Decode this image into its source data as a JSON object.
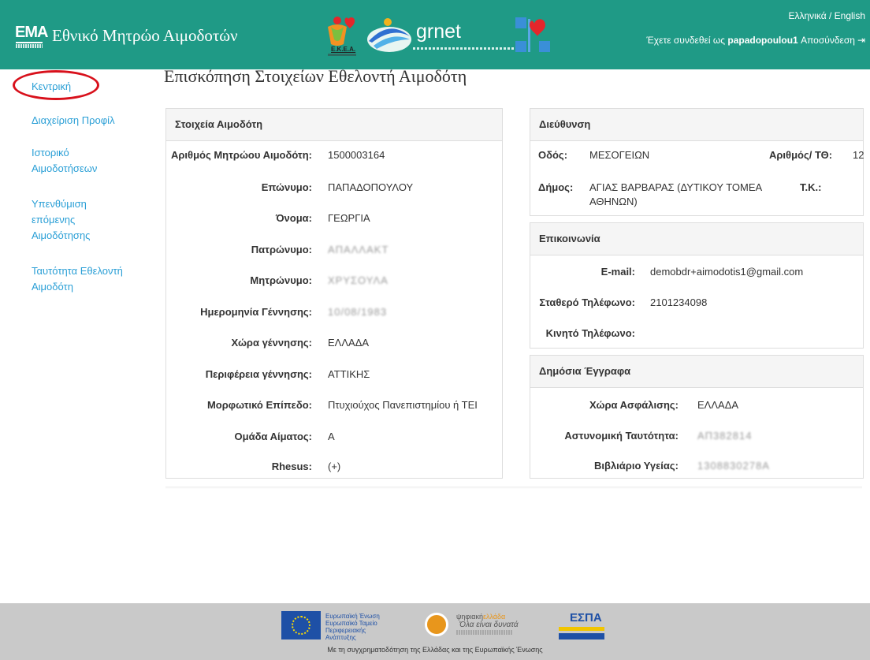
{
  "header": {
    "logo_text": "ΕΜΑ",
    "site_title": "Εθνικό Μητρώο Αιμοδοτών",
    "ekea_label": "Ε.Κ.Ε.Α.",
    "grnet_label": "grnet",
    "language_switch": "Ελληνικά / English",
    "login_prefix": "Έχετε συνδεθεί ως",
    "username": "papadopoulou1",
    "logout_label": "Αποσύνδεση",
    "colors": {
      "header_bg": "#1f9a86",
      "link": "#2a9fd6",
      "highlight_circle": "#d8101b"
    }
  },
  "sidebar": {
    "items": [
      {
        "label": "Κεντρική"
      },
      {
        "label": "Διαχείριση Προφίλ"
      },
      {
        "label": "Ιστορικό Αιμοδοτήσεων"
      },
      {
        "label": "Υπενθύμιση επόμενης Αιμοδότησης"
      },
      {
        "label": "Ταυτότητα Εθελοντή Αιμοδότη"
      }
    ]
  },
  "main": {
    "page_title": "Επισκόπηση Στοιχείων Εθελοντή Αιμοδότη",
    "donor_panel": {
      "title": "Στοιχεία Αιμοδότη",
      "fields": [
        {
          "label": "Αριθμός Μητρώου Αιμοδότη:",
          "value": "1500003164"
        },
        {
          "label": "Επώνυμο:",
          "value": "ΠΑΠΑΔΟΠΟΥΛΟΥ"
        },
        {
          "label": "Όνομα:",
          "value": "ΓΕΩΡΓΙΑ"
        },
        {
          "label": "Πατρώνυμο:",
          "value": "ΑΠΑΛΛΑΚΤ"
        },
        {
          "label": "Μητρώνυμο:",
          "value": "ΧΡΥΣΟΥΛΑ"
        },
        {
          "label": "Ημερομηνία Γέννησης:",
          "value": "10/08/1983"
        },
        {
          "label": "Χώρα γέννησης:",
          "value": "ΕΛΛΑΔΑ"
        },
        {
          "label": "Περιφέρεια γέννησης:",
          "value": "ΑΤΤΙΚΗΣ"
        },
        {
          "label": "Μορφωτικό Επίπεδο:",
          "value": "Πτυχιούχος Πανεπιστημίου ή ΤΕΙ"
        },
        {
          "label": "Ομάδα Αίματος:",
          "value": "A"
        },
        {
          "label": "Rhesus:",
          "value": "(+)"
        }
      ]
    },
    "address_panel": {
      "title": "Διεύθυνση",
      "street_label": "Οδός:",
      "street_value": "ΜΕΣΟΓΕΙΩΝ",
      "number_label": "Αριθμός/ ΤΘ:",
      "number_value": "12",
      "municipality_label": "Δήμος:",
      "municipality_value_line1": "ΑΓΙΑΣ ΒΑΡΒΑΡΑΣ (ΔΥΤΙΚΟΥ ΤΟΜΕΑ",
      "municipality_value_line2": "ΑΘΗΝΩΝ)",
      "postal_label": "Τ.Κ.:",
      "postal_value": ""
    },
    "contact_panel": {
      "title": "Επικοινωνία",
      "email_label": "E-mail:",
      "email_value": "demobdr+aimodotis1@gmail.com",
      "phone_label": "Σταθερό Τηλέφωνο:",
      "phone_value": "2101234098",
      "mobile_label": "Κινητό Τηλέφωνο:",
      "mobile_value": ""
    },
    "documents_panel": {
      "title": "Δημόσια Έγγραφα",
      "insurance_country_label": "Χώρα Ασφάλισης:",
      "insurance_country_value": "ΕΛΛΑΔΑ",
      "police_id_label": "Αστυνομική Ταυτότητα:",
      "police_id_value": "ΑΠ382814",
      "health_book_label": "Βιβλιάριο Υγείας:",
      "health_book_value": "1308830278Α"
    }
  },
  "footer": {
    "eu_text": [
      "Ευρωπαϊκή Ένωση",
      "Ευρωπαϊκό Ταμείο",
      "Περιφερειακής",
      "Ανάπτυξης"
    ],
    "digital_title_a": "ψηφιακή",
    "digital_title_b": "ελλάδα",
    "digital_slogan": "Όλα είναι δυνατά",
    "espa_label": "ΕΣΠΑ",
    "caption": "Με τη συγχρηματοδότηση της Ελλάδας και της Ευρωπαϊκής Ένωσης"
  }
}
